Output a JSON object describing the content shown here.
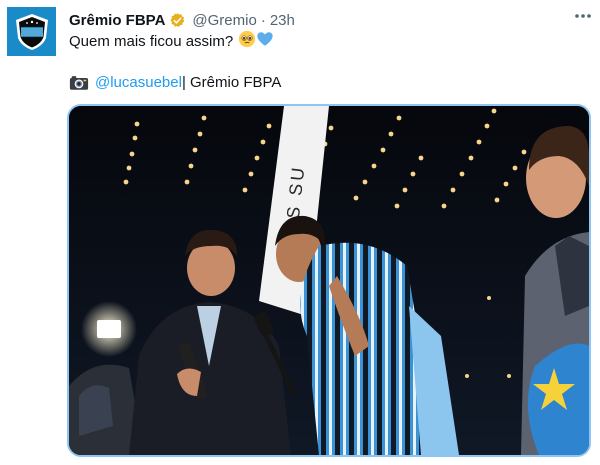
{
  "account": {
    "display_name": "Grêmio FBPA",
    "handle": "@Gremio",
    "separator": "·",
    "time": "23h",
    "avatar_icon": "gremio-crest-icon",
    "verified_icon": "verified-badge-icon"
  },
  "tweet": {
    "line1": "Quem mais ficou assim?",
    "camera_icon": "camera-icon",
    "mention": "@lucasuebel",
    "credit": " | Grêmio FBPA"
  },
  "media": {
    "banner_text": "LUIS SU"
  },
  "colors": {
    "accent": "#1d9bf0",
    "verified": "#e8b01c",
    "club_blue": "#1a8ac9",
    "media_border": "#8ec5f2"
  }
}
